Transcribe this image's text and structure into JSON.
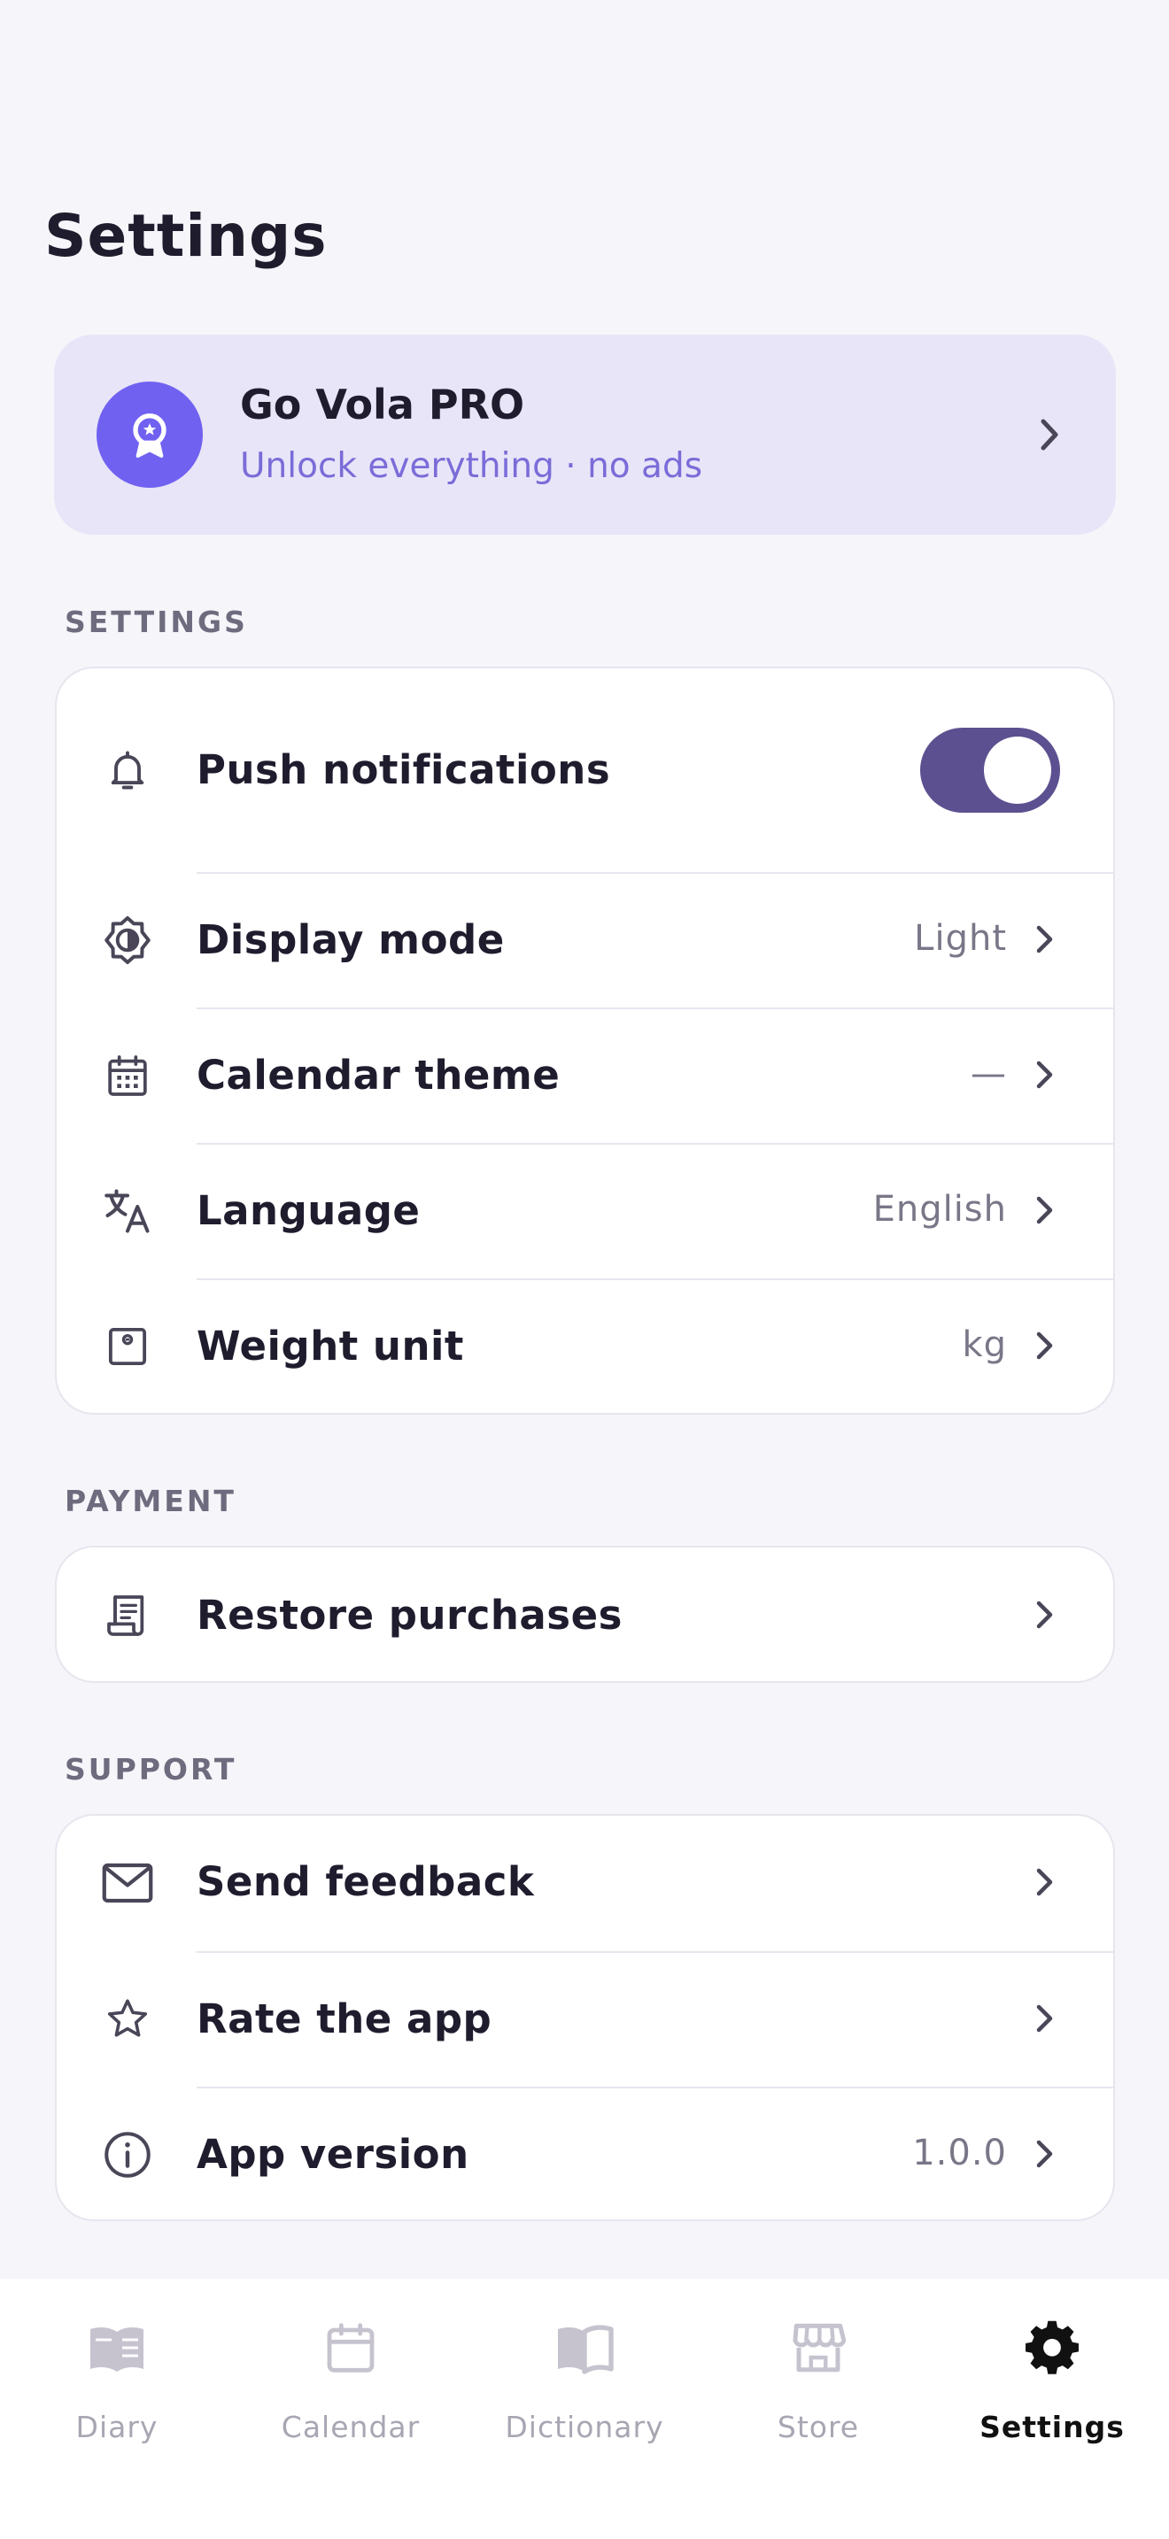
{
  "page": {
    "title": "Settings"
  },
  "pro": {
    "title": "Go Vola PRO",
    "subtitle": "Unlock everything · no ads"
  },
  "sections": {
    "settings": "SETTINGS",
    "payment": "PAYMENT",
    "support": "SUPPORT"
  },
  "settings_items": {
    "push": {
      "label": "Push notifications",
      "toggle_on": true
    },
    "display": {
      "label": "Display mode",
      "value": "Light"
    },
    "calendar": {
      "label": "Calendar theme",
      "value": "—"
    },
    "language": {
      "label": "Language",
      "value": "English"
    },
    "weight": {
      "label": "Weight unit",
      "value": "kg"
    }
  },
  "payment_items": {
    "restore": {
      "label": "Restore purchases"
    }
  },
  "support_items": {
    "feedback": {
      "label": "Send feedback"
    },
    "rate": {
      "label": "Rate the app"
    },
    "version": {
      "label": "App version",
      "value": "1.0.0"
    }
  },
  "tabbar": {
    "diary": "Diary",
    "calendar": "Calendar",
    "dictionary": "Dictionary",
    "store": "Store",
    "settings": "Settings",
    "active": "settings"
  },
  "colors": {
    "accent": "#7061f1",
    "toggle_on": "#5d5090",
    "pro_bg": "#e8e5f8",
    "background": "#f6f5fa"
  }
}
